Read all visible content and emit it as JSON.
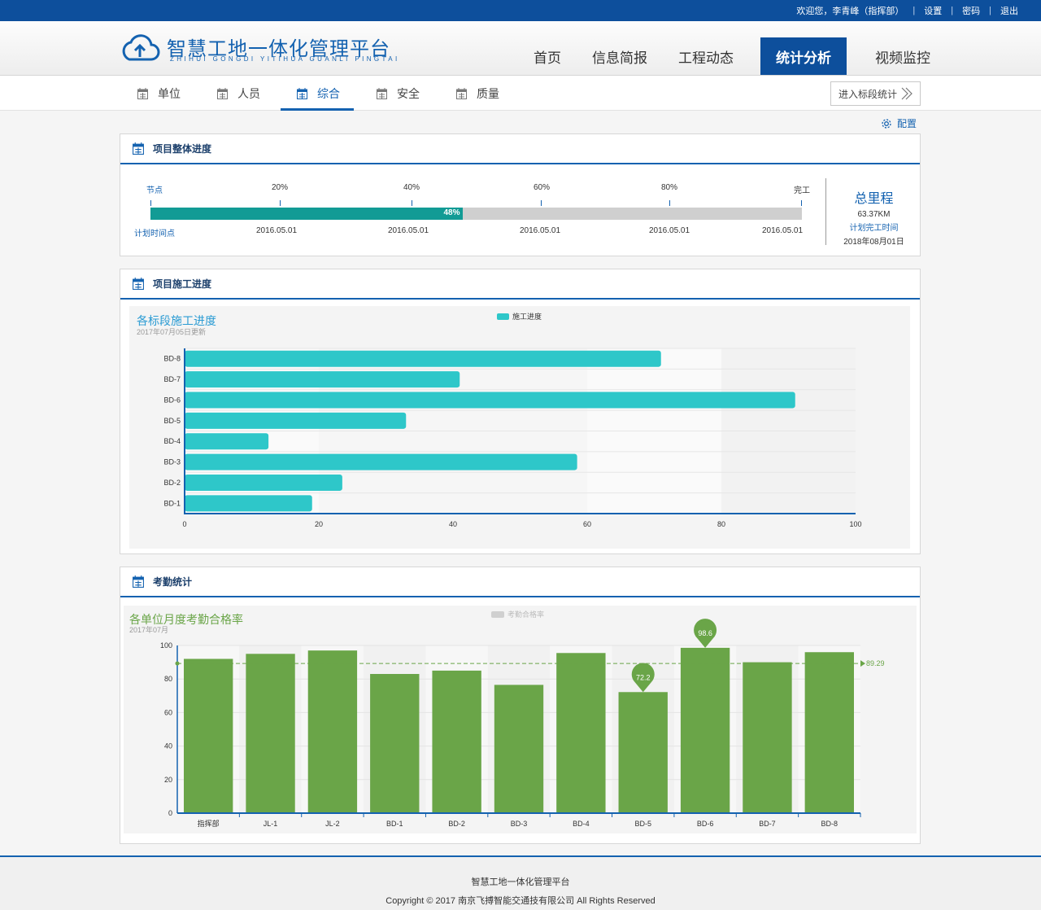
{
  "topbar": {
    "welcome": "欢迎您，李青峰（指挥部）",
    "settings": "设置",
    "password": "密码",
    "logout": "退出",
    "separator": "|"
  },
  "header": {
    "title": "智慧工地一体化管理平台",
    "subtitle": "ZHIHUI GONGDI YITIHUA GUANLI PINGTAI",
    "nav": [
      "首页",
      "信息简报",
      "工程动态",
      "统计分析",
      "视频监控"
    ],
    "active_nav": "统计分析"
  },
  "subnav": {
    "tabs": [
      "单位",
      "人员",
      "综合",
      "安全",
      "质量"
    ],
    "active_tab": "综合",
    "enter_button": "进入标段统计"
  },
  "config_label": "配置",
  "overall": {
    "title": "项目整体进度",
    "node_label": "节点",
    "plan_label": "计划时间点",
    "milestones": [
      "20%",
      "40%",
      "60%",
      "80%",
      "完工"
    ],
    "plan_dates": [
      "2016.05.01",
      "2016.05.01",
      "2016.05.01",
      "2016.05.01",
      "2016.05.01"
    ],
    "progress": 0.48,
    "progress_label": "48%",
    "total_title": "总里程",
    "total_value": "63.37KM",
    "finish_label": "计划完工时间",
    "finish_date": "2018年08月01日"
  },
  "construction": {
    "title": "项目施工进度",
    "chart_title": "各标段施工进度",
    "chart_subtitle": "2017年07月05日更新",
    "legend": "施工进度",
    "color": "#2ec7c9"
  },
  "attendance": {
    "title": "考勤统计",
    "chart_title": "各单位月度考勤合格率",
    "chart_subtitle": "2017年07月",
    "legend": "考勤合格率",
    "color": "#6aa548",
    "avg_label": "89.29",
    "max_label": "98.6",
    "min_label": "72.2"
  },
  "chart_data": [
    {
      "type": "bar",
      "orientation": "horizontal",
      "title": "各标段施工进度",
      "subtitle": "2017年07月05日更新",
      "categories": [
        "BD-1",
        "BD-2",
        "BD-3",
        "BD-4",
        "BD-5",
        "BD-6",
        "BD-7",
        "BD-8"
      ],
      "series": [
        {
          "name": "施工进度",
          "values": [
            19,
            23.5,
            58.5,
            12.5,
            33,
            91,
            41,
            71
          ]
        }
      ],
      "xlim": [
        0,
        100
      ],
      "xticks": [
        0,
        20,
        40,
        60,
        80,
        100
      ],
      "legend": "top-center"
    },
    {
      "type": "bar",
      "title": "各单位月度考勤合格率",
      "subtitle": "2017年07月",
      "categories": [
        "指挥部",
        "JL-1",
        "JL-2",
        "BD-1",
        "BD-2",
        "BD-3",
        "BD-4",
        "BD-5",
        "BD-6",
        "BD-7",
        "BD-8"
      ],
      "series": [
        {
          "name": "考勤合格率",
          "values": [
            92,
            95,
            97,
            83,
            85,
            76.5,
            95.5,
            72.2,
            98.6,
            90,
            96
          ]
        }
      ],
      "ylim": [
        0,
        100
      ],
      "yticks": [
        0,
        20,
        40,
        60,
        80,
        100
      ],
      "average": 89.29,
      "mark_points": {
        "max": 98.6,
        "min": 72.2
      },
      "legend": "top-center"
    }
  ],
  "footer": {
    "name": "智慧工地一体化管理平台",
    "copyright": "Copyright © 2017 南京飞搏智能交通技有限公司 All Rights Reserved"
  }
}
